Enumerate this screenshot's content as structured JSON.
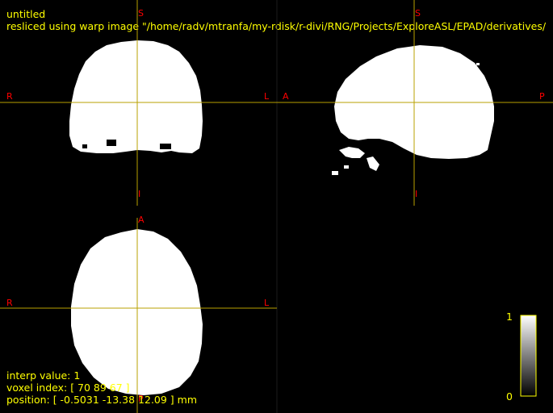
{
  "header": {
    "title": "untitled",
    "subtitle": "resliced using warp image \"/home/radv/mtranfa/my-rdisk/r-divi/RNG/Projects/ExploreASL/EPAD/derivatives/"
  },
  "views": {
    "coronal": {
      "top": "S",
      "bottom": "I",
      "left": "R",
      "right": "L"
    },
    "sagittal": {
      "top": "S",
      "bottom": "I",
      "left": "A",
      "right": "P"
    },
    "axial": {
      "top": "A",
      "bottom": "P",
      "left": "R",
      "right": "L"
    }
  },
  "readout": {
    "interp": "interp value: 1",
    "voxel": "voxel index: [ 70 89 67 ]",
    "position": "position: [ -0.5031 -13.38 12.09 ] mm"
  },
  "colorbar": {
    "max_label": "1",
    "min_label": "0"
  },
  "colors": {
    "text": "#ffff00",
    "orientation": "#ff0000",
    "crosshair": "#b8a000",
    "mask": "#ffffff"
  }
}
